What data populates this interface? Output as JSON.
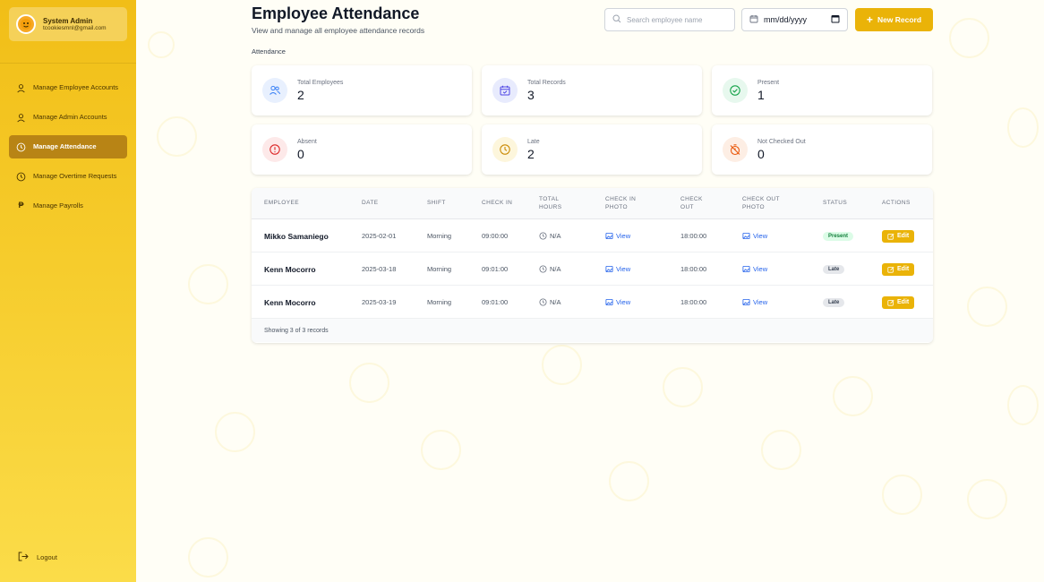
{
  "sidebar": {
    "user_name": "System Admin",
    "user_email": "tcookiesmnl@gmail.com",
    "items": [
      {
        "label": "Manage Employee Accounts",
        "icon": "user-icon"
      },
      {
        "label": "Manage Admin Accounts",
        "icon": "user-icon"
      },
      {
        "label": "Manage Attendance",
        "icon": "clock-icon",
        "active": true
      },
      {
        "label": "Manage Overtime Requests",
        "icon": "clock-icon"
      },
      {
        "label": "Manage Payrolls",
        "icon": "peso-icon"
      }
    ],
    "logout_label": "Logout"
  },
  "header": {
    "title": "Employee Attendance",
    "subtitle": "View and manage all employee attendance records",
    "section_label": "Attendance",
    "search_placeholder": "Search employee name",
    "date_placeholder": "mm/dd/yyyy",
    "new_record_label": "New Record"
  },
  "stats": [
    {
      "label": "Total Employees",
      "value": "2",
      "icon": "users-icon",
      "color": "#3b82f6",
      "bg": "#e8f0fe"
    },
    {
      "label": "Total Records",
      "value": "3",
      "icon": "calendar-check-icon",
      "color": "#4f46e5",
      "bg": "#e8ebfd"
    },
    {
      "label": "Present",
      "value": "1",
      "icon": "check-circle-icon",
      "color": "#16a34a",
      "bg": "#e7f8ee"
    },
    {
      "label": "Absent",
      "value": "0",
      "icon": "alert-circle-icon",
      "color": "#dc2626",
      "bg": "#fde9e9"
    },
    {
      "label": "Late",
      "value": "2",
      "icon": "clock-icon",
      "color": "#ca8a04",
      "bg": "#fdf6dc"
    },
    {
      "label": "Not Checked Out",
      "value": "0",
      "icon": "timer-off-icon",
      "color": "#ea580c",
      "bg": "#fdeee4"
    }
  ],
  "table": {
    "headers": [
      "EMPLOYEE",
      "DATE",
      "SHIFT",
      "CHECK IN",
      "TOTAL HOURS",
      "CHECK IN PHOTO",
      "CHECK OUT",
      "CHECK OUT PHOTO",
      "STATUS",
      "ACTIONS"
    ],
    "rows": [
      {
        "employee": "Mikko Samaniego",
        "date": "2025-02-01",
        "shift": "Morning",
        "check_in": "09:00:00",
        "total_hours": "N/A",
        "check_in_photo": "View",
        "check_out": "18:00:00",
        "check_out_photo": "View",
        "status": "Present",
        "action": "Edit"
      },
      {
        "employee": "Kenn Mocorro",
        "date": "2025-03-18",
        "shift": "Morning",
        "check_in": "09:01:00",
        "total_hours": "N/A",
        "check_in_photo": "View",
        "check_out": "18:00:00",
        "check_out_photo": "View",
        "status": "Late",
        "action": "Edit"
      },
      {
        "employee": "Kenn Mocorro",
        "date": "2025-03-19",
        "shift": "Morning",
        "check_in": "09:01:00",
        "total_hours": "N/A",
        "check_in_photo": "View",
        "check_out": "18:00:00",
        "check_out_photo": "View",
        "status": "Late",
        "action": "Edit"
      }
    ],
    "footer": "Showing 3 of 3 records"
  },
  "colors": {
    "accent": "#eab308",
    "sidebar_active": "#b88415",
    "link": "#2563eb"
  }
}
